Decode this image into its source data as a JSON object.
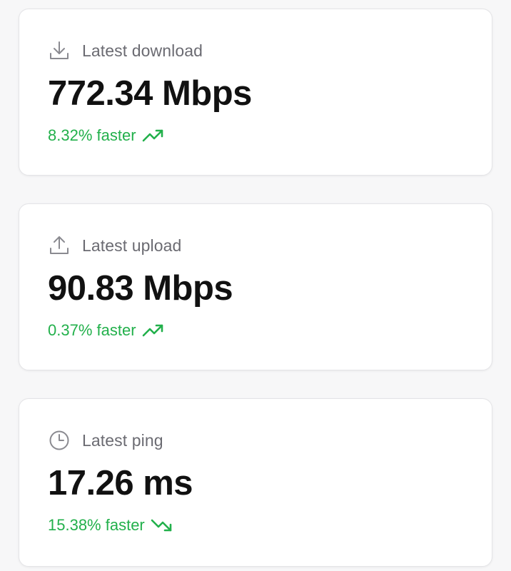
{
  "colors": {
    "positive": "#22b04b",
    "icon_stroke": "#8a8a90",
    "label": "#6b6b72",
    "value": "#111111"
  },
  "stats": [
    {
      "icon": "download-icon",
      "label": "Latest download",
      "value": "772.34 Mbps",
      "change": "8.32% faster",
      "trend_icon": "trending-up-icon"
    },
    {
      "icon": "upload-icon",
      "label": "Latest upload",
      "value": "90.83 Mbps",
      "change": "0.37% faster",
      "trend_icon": "trending-up-icon"
    },
    {
      "icon": "clock-icon",
      "label": "Latest ping",
      "value": "17.26 ms",
      "change": "15.38% faster",
      "trend_icon": "trending-down-icon"
    }
  ]
}
